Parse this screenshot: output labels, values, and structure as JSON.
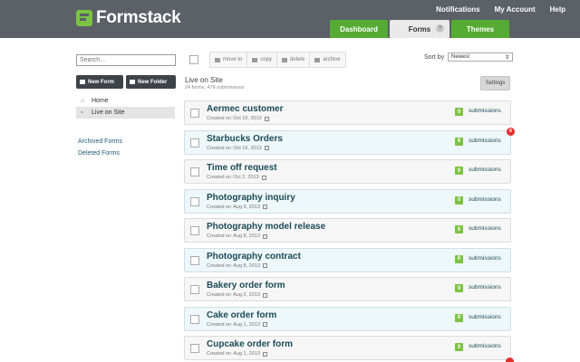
{
  "header": {
    "logo_text": "Formstack",
    "top_links": [
      "Notifications",
      "My Account",
      "Help"
    ],
    "tabs": [
      {
        "label": "Dashboard"
      },
      {
        "label": "Forms",
        "help": "?"
      },
      {
        "label": "Themes"
      }
    ]
  },
  "sidebar": {
    "search_placeholder": "Search...",
    "new_form": "New Form",
    "new_folder": "New Folder",
    "nav": [
      {
        "label": "Home"
      },
      {
        "label": "Live on Site"
      }
    ],
    "links": [
      "Archived Forms",
      "Deleted Forms"
    ]
  },
  "toolbar": {
    "actions": [
      "move to",
      "copy",
      "delete",
      "archive"
    ],
    "sort_label": "Sort by",
    "sort_value": "Newest"
  },
  "folder": {
    "title": "Live on Site",
    "count": "24 forms, 478 submissions",
    "settings": "Settings"
  },
  "forms": [
    {
      "name": "Aermec customer",
      "created_label": "Created on",
      "date": "Oct 16, 2013",
      "count": "0",
      "sub": "submissions"
    },
    {
      "name": "Starbucks Orders",
      "created_label": "Created on",
      "date": "Oct 16, 2013",
      "count": "6",
      "sub": "submissions",
      "badge": "6"
    },
    {
      "name": "Time off request",
      "created_label": "Created on",
      "date": "Oct 2, 2013",
      "count": "0",
      "sub": "submissions"
    },
    {
      "name": "Photography inquiry",
      "created_label": "Created on",
      "date": "Aug 9, 2013",
      "count": "0",
      "sub": "submissions"
    },
    {
      "name": "Photography model release",
      "created_label": "Created on",
      "date": "Aug 8, 2013",
      "count": "0",
      "sub": "submissions"
    },
    {
      "name": "Photography contract",
      "created_label": "Created on",
      "date": "Aug 8, 2013",
      "count": "0",
      "sub": "submissions"
    },
    {
      "name": "Bakery order form",
      "created_label": "Created on",
      "date": "Aug 2, 2013",
      "count": "0",
      "sub": "submissions"
    },
    {
      "name": "Cake order form",
      "created_label": "Created on",
      "date": "Aug 1, 2013",
      "count": "0",
      "sub": "submissions"
    },
    {
      "name": "Cupcake order form",
      "created_label": "Created on",
      "date": "Aug 1, 2013",
      "count": "0",
      "sub": "submissions"
    }
  ]
}
